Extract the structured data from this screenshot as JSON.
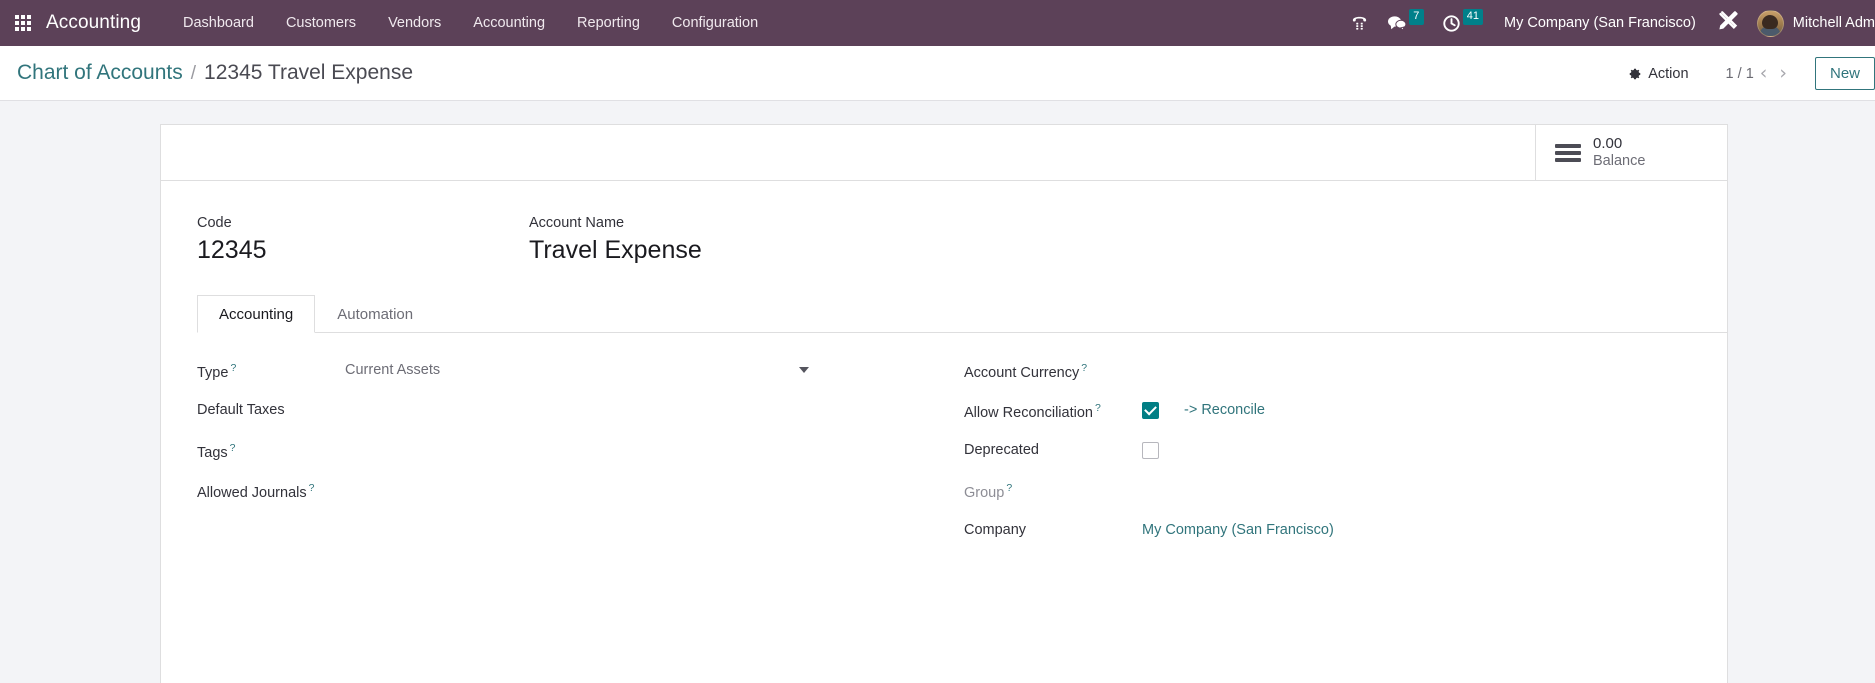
{
  "navbar": {
    "apps_icon": "apps-grid-icon",
    "brand": "Accounting",
    "menu": [
      {
        "label": "Dashboard"
      },
      {
        "label": "Customers"
      },
      {
        "label": "Vendors"
      },
      {
        "label": "Accounting"
      },
      {
        "label": "Reporting"
      },
      {
        "label": "Configuration"
      }
    ],
    "systray": {
      "voip_icon": "phone-keypad-icon",
      "messages_icon": "chat-bubble-icon",
      "messages_count": "7",
      "activities_icon": "clock-icon",
      "activities_count": "41",
      "company": "My Company (San Francisco)",
      "debug_icon": "tools-wrench-icon",
      "user_avatar": "user-avatar",
      "user_name": "Mitchell Adm"
    },
    "accent_badge_color": "#00808a",
    "navbar_color": "#5c4158"
  },
  "control_panel": {
    "breadcrumb_root": "Chart of Accounts",
    "breadcrumb_separator": "/",
    "breadcrumb_current": "12345 Travel Expense",
    "action_icon": "gear-icon",
    "action_label": "Action",
    "pager_value": "1 / 1",
    "pager_prev_icon": "chevron-left-icon",
    "pager_next_icon": "chevron-right-icon",
    "new_label": "New",
    "link_color": "#31757c"
  },
  "sheet": {
    "stat_buttons": [
      {
        "icon": "balance-lines-icon",
        "value": "0.00",
        "label": "Balance"
      }
    ],
    "title": {
      "code_label": "Code",
      "code_value": "12345",
      "name_label": "Account Name",
      "name_value": "Travel Expense"
    },
    "tabs": [
      {
        "label": "Accounting",
        "active": true
      },
      {
        "label": "Automation",
        "active": false
      }
    ],
    "tooltip_marker": "?",
    "form": {
      "left": [
        {
          "label": "Type",
          "tooltip": true,
          "widget": "select",
          "value": "Current Assets",
          "caret_icon": "chevron-down-icon"
        },
        {
          "label": "Default Taxes",
          "tooltip": false,
          "widget": "text",
          "value": ""
        },
        {
          "label": "Tags",
          "tooltip": true,
          "widget": "text",
          "value": ""
        },
        {
          "label": "Allowed Journals",
          "tooltip": true,
          "widget": "text",
          "value": ""
        }
      ],
      "right": [
        {
          "label": "Account Currency",
          "tooltip": true,
          "widget": "text",
          "value": ""
        },
        {
          "label": "Allow Reconciliation",
          "tooltip": true,
          "widget": "checkbox",
          "checked": true,
          "link": "-> Reconcile"
        },
        {
          "label": "Deprecated",
          "tooltip": false,
          "widget": "checkbox",
          "checked": false,
          "link": ""
        },
        {
          "label": "Group",
          "tooltip": true,
          "widget": "text",
          "value": "",
          "muted": true
        },
        {
          "label": "Company",
          "tooltip": false,
          "widget": "link",
          "value": "My Company (San Francisco)"
        }
      ]
    }
  },
  "colors": {
    "navbar": "#5c4158",
    "accent_teal": "#31757c",
    "checkbox_teal": "#017e84",
    "badge_teal": "#00808a",
    "page_bg": "#f3f4f7"
  }
}
